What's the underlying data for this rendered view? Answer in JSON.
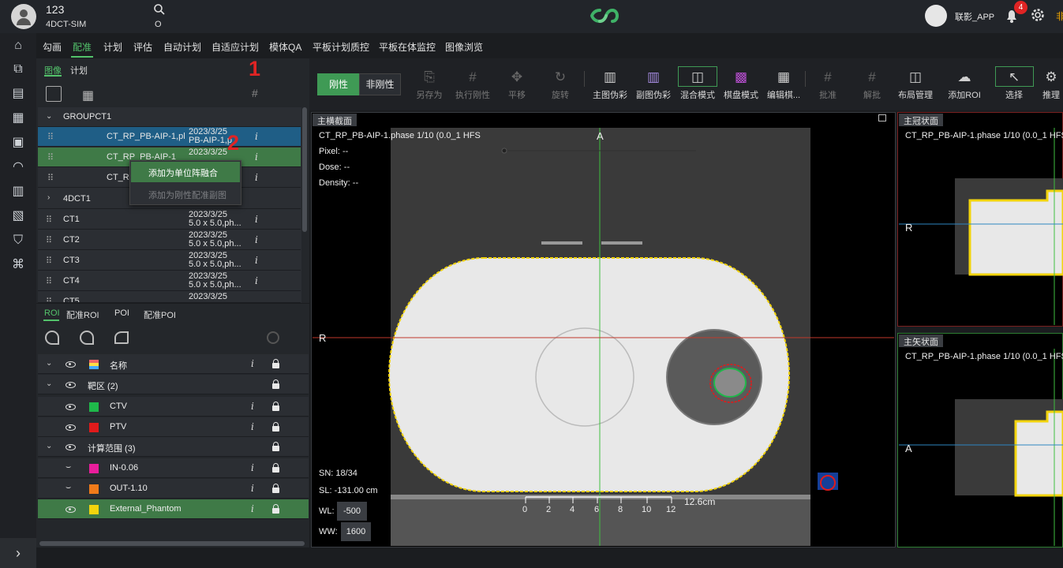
{
  "top": {
    "user_name": "123",
    "user_sub": "4DCT-SIM",
    "search_sub": "O",
    "app_user": "联影_APP",
    "notif_count": "4",
    "trailing_text": "非"
  },
  "menu": [
    "勾画",
    "配准",
    "计划",
    "评估",
    "自动计划",
    "自适应计划",
    "模体QA",
    "平板计划质控",
    "平板在体监控",
    "图像浏览"
  ],
  "left": {
    "tabs": [
      "图像",
      "计划"
    ],
    "annot1": "1",
    "annot2": "2",
    "groups": [
      {
        "label": "GROUPCT1"
      },
      {
        "label": "4DCT1"
      }
    ],
    "group_rows": [
      {
        "name": "CT_RP_PB-AIP-1,pl",
        "date": "2023/3/25",
        "sub": "PB-AIP-1,p"
      },
      {
        "name": "CT_RP_PB-AIP-1",
        "date": "2023/3/25",
        "sub": ""
      },
      {
        "name": "CT_RP",
        "date": "",
        "sub": ""
      }
    ],
    "ct_rows": [
      {
        "name": "CT1",
        "date": "2023/3/25",
        "sub": "5.0 x 5.0,ph..."
      },
      {
        "name": "CT2",
        "date": "2023/3/25",
        "sub": "5.0 x 5.0,ph..."
      },
      {
        "name": "CT3",
        "date": "2023/3/25",
        "sub": "5.0 x 5.0,ph..."
      },
      {
        "name": "CT4",
        "date": "2023/3/25",
        "sub": "5.0 x 5.0,ph..."
      },
      {
        "name": "CT5",
        "date": "2023/3/25",
        "sub": ""
      }
    ],
    "context_menu": [
      "添加为单位阵融合",
      "添加为刚性配准副图"
    ],
    "roi_tabs": [
      "ROI",
      "配准ROI",
      "POI",
      "配准POI"
    ],
    "roi_header": "名称",
    "roi_groups": [
      {
        "label": "靶区 (2)"
      },
      {
        "label": "计算范围 (3)"
      }
    ],
    "rois": [
      {
        "name": "CTV",
        "color": "#1fb84a"
      },
      {
        "name": "PTV",
        "color": "#e01b1b"
      },
      {
        "name": "IN-0.06",
        "color": "#e81e9c"
      },
      {
        "name": "OUT-1.10",
        "color": "#f07b1a"
      },
      {
        "name": "External_Phantom",
        "color": "#f2d40d"
      }
    ]
  },
  "toolbar": {
    "rigid": "刚性",
    "nonrigid": "非刚性",
    "items": [
      "另存为",
      "执行刚性",
      "平移",
      "旋转",
      "主图伪彩",
      "副图伪彩",
      "混合模式",
      "棋盘模式",
      "编辑棋...",
      "批准",
      "解批",
      "布局管理",
      "添加ROI",
      "选择",
      "推理"
    ]
  },
  "viewer_main": {
    "title": "主横截面",
    "series": "CT_RP_PB-AIP-1.phase 1/10 (0.0_1 HFS",
    "pixel": "Pixel:  --",
    "dose": "Dose:  --",
    "density": "Density:  --",
    "orient_top": "A",
    "orient_left": "R",
    "sn": "SN: 18/34",
    "sl": "SL: -131.00 cm",
    "wl_label": "WL:",
    "wl": "-500",
    "ww_label": "WW:",
    "ww": "1600",
    "scale_labels": [
      "0",
      "2",
      "4",
      "6",
      "8",
      "10",
      "12"
    ],
    "scale_text": "12.6cm"
  },
  "viewer_coronal": {
    "title": "主冠状面",
    "series": "CT_RP_PB-AIP-1.phase 1/10 (0.0_1 HFS",
    "orient": "R"
  },
  "viewer_sagittal": {
    "title": "主矢状面",
    "series": "CT_RP_PB-AIP-1.phase 1/10 (0.0_1 HFS",
    "orient": "A"
  },
  "colors": {
    "accent": "#53c36b",
    "selected_row": "#1f5e86",
    "active_row": "#3f7a47"
  }
}
